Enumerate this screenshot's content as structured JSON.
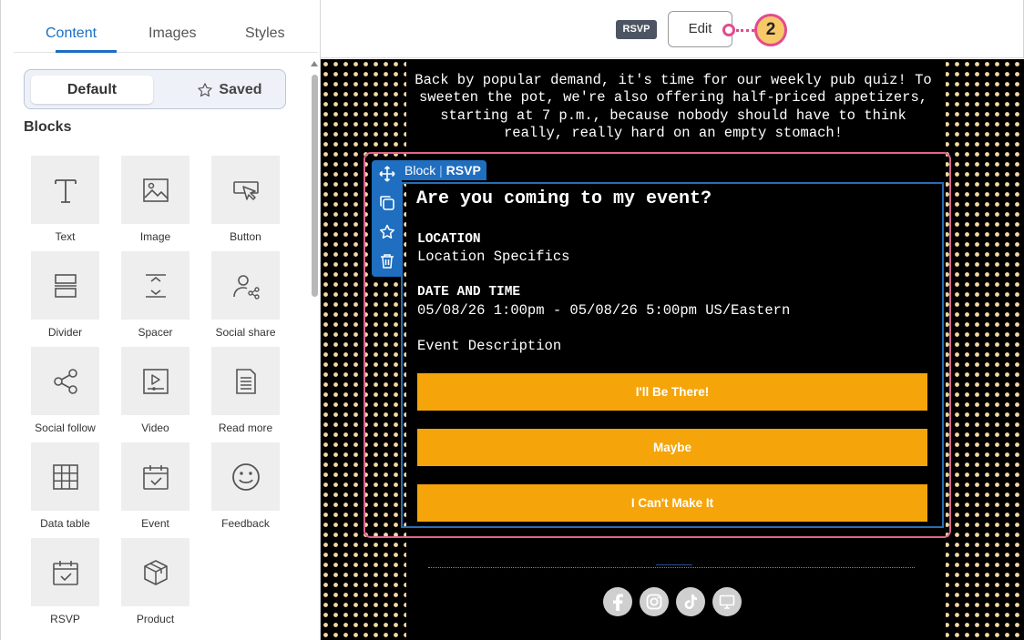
{
  "sidebar": {
    "tabs": [
      {
        "label": "Content",
        "active": true
      },
      {
        "label": "Images",
        "active": false
      },
      {
        "label": "Styles",
        "active": false
      }
    ],
    "segment": {
      "default_label": "Default",
      "saved_label": "Saved"
    },
    "blocks_title": "Blocks",
    "blocks": [
      {
        "label": "Text",
        "icon": "text-icon"
      },
      {
        "label": "Image",
        "icon": "image-icon"
      },
      {
        "label": "Button",
        "icon": "button-icon"
      },
      {
        "label": "Divider",
        "icon": "divider-icon"
      },
      {
        "label": "Spacer",
        "icon": "spacer-icon"
      },
      {
        "label": "Social share",
        "icon": "social-share-icon"
      },
      {
        "label": "Social follow",
        "icon": "social-follow-icon"
      },
      {
        "label": "Video",
        "icon": "video-icon"
      },
      {
        "label": "Read more",
        "icon": "read-more-icon"
      },
      {
        "label": "Data table",
        "icon": "data-table-icon"
      },
      {
        "label": "Event",
        "icon": "event-icon"
      },
      {
        "label": "Feedback",
        "icon": "feedback-icon"
      },
      {
        "label": "RSVP",
        "icon": "rsvp-icon"
      },
      {
        "label": "Product",
        "icon": "product-icon"
      }
    ]
  },
  "topbar": {
    "badge": "RSVP",
    "edit_label": "Edit",
    "callout_number": "2",
    "callout_color": "#e24b8f"
  },
  "email": {
    "intro": "Back by popular demand, it's time for our weekly pub quiz! To sweeten the pot, we're also offering half-priced appetizers, starting at 7 p.m., because nobody should have to think really, really hard on an empty stomach!",
    "block_tag": {
      "prefix": "Block",
      "name": "RSVP"
    },
    "rsvp": {
      "title": "Are you coming to my event?",
      "location_label": "LOCATION",
      "location_value": "Location Specifics",
      "datetime_label": "DATE AND TIME",
      "datetime_value": "05/08/26 1:00pm - 05/08/26 5:00pm US/Eastern",
      "description": "Event Description",
      "buttons": [
        "I'll Be There!",
        "Maybe",
        "I Can't Make It"
      ],
      "button_color": "#f5a50a"
    },
    "social_icons": [
      "facebook-icon",
      "instagram-icon",
      "tiktok-icon",
      "website-icon"
    ]
  },
  "colors": {
    "accent_blue": "#1b6ec2",
    "selection_pink": "#e0648e",
    "canvas_bg": "#000000",
    "dot_color": "#f6d9a3"
  }
}
